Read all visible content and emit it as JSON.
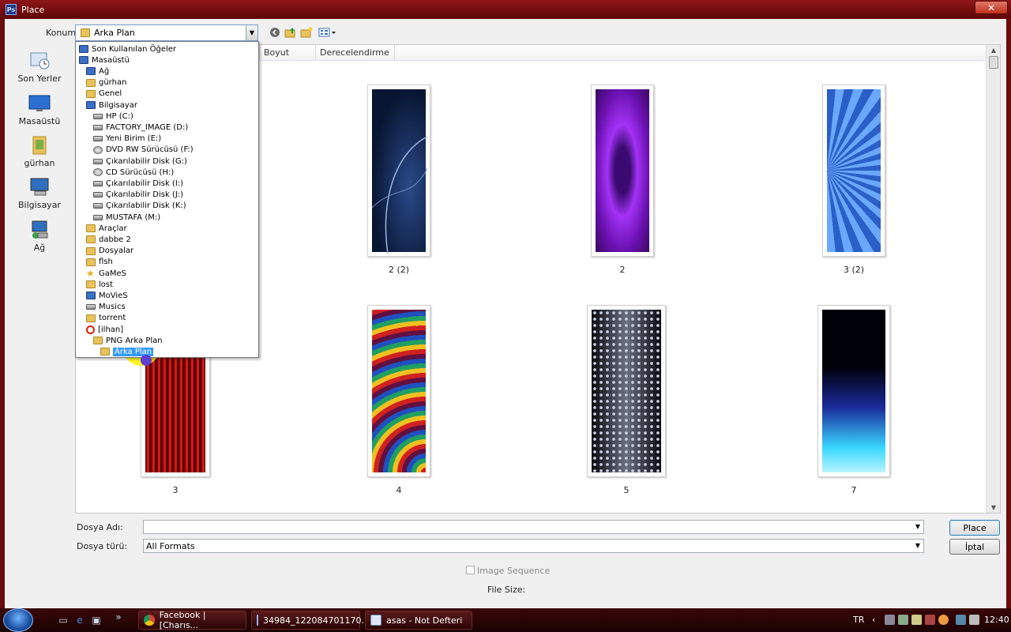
{
  "window": {
    "title": "Place",
    "close_glyph": "✕"
  },
  "location": {
    "label": "Konum:",
    "value": "Arka Plan"
  },
  "places": [
    {
      "label": "Son Yerler",
      "icon": "recent-places-icon"
    },
    {
      "label": "Masaüstü",
      "icon": "desktop-icon"
    },
    {
      "label": "gürhan",
      "icon": "user-folder-icon"
    },
    {
      "label": "Bilgisayar",
      "icon": "computer-icon"
    },
    {
      "label": "Ağ",
      "icon": "network-icon"
    }
  ],
  "columns": {
    "size": "Boyut",
    "rating": "Derecelendirme"
  },
  "files": [
    {
      "name": "2 (2)",
      "colors": [
        "#0a1a3a",
        "#1b3a6a"
      ]
    },
    {
      "name": "2",
      "colors": [
        "#5a0a9a",
        "#9b2df0"
      ]
    },
    {
      "name": "3 (2)",
      "colors": [
        "#2a5fc8",
        "#7ab8ff"
      ]
    },
    {
      "name": "3",
      "colors": [
        "#5a0000",
        "#d11a1a"
      ]
    },
    {
      "name": "4",
      "colors": [
        "#4a0a1a",
        "#f0a020"
      ]
    },
    {
      "name": "5",
      "colors": [
        "#0a0a10",
        "#9aa0b0"
      ]
    },
    {
      "name": "7",
      "colors": [
        "#000008",
        "#39d8ff"
      ]
    }
  ],
  "dropdown": [
    {
      "label": "Son Kullanılan Öğeler",
      "icon": "recent-items-icon",
      "indent": 0
    },
    {
      "label": "Masaüstü",
      "icon": "desktop-icon",
      "indent": 0
    },
    {
      "label": "Ağ",
      "icon": "network-icon",
      "indent": 1
    },
    {
      "label": "gürhan",
      "icon": "user-folder-icon",
      "indent": 1
    },
    {
      "label": "Genel",
      "icon": "folder-icon",
      "indent": 1
    },
    {
      "label": "Bilgisayar",
      "icon": "computer-icon",
      "indent": 1
    },
    {
      "label": "HP (C:)",
      "icon": "drive-icon",
      "indent": 2
    },
    {
      "label": "FACTORY_IMAGE (D:)",
      "icon": "drive-icon",
      "indent": 2
    },
    {
      "label": "Yeni Birim (E:)",
      "icon": "drive-icon",
      "indent": 2
    },
    {
      "label": "DVD RW Sürücüsü (F:)",
      "icon": "disc-drive-icon",
      "indent": 2
    },
    {
      "label": "Çıkarılabilir Disk (G:)",
      "icon": "removable-disk-icon",
      "indent": 2
    },
    {
      "label": "CD Sürücüsü (H:)",
      "icon": "disc-drive-icon",
      "indent": 2
    },
    {
      "label": "Çıkarılabilir Disk (I:)",
      "icon": "removable-disk-icon",
      "indent": 2
    },
    {
      "label": "Çıkarılabilir Disk (J:)",
      "icon": "removable-disk-icon",
      "indent": 2
    },
    {
      "label": "Çıkarılabilir Disk (K:)",
      "icon": "removable-disk-icon",
      "indent": 2
    },
    {
      "label": "MUSTAFA (M:)",
      "icon": "removable-disk-icon",
      "indent": 2
    },
    {
      "label": "Araçlar",
      "icon": "folder-icon",
      "indent": 1
    },
    {
      "label": "dabbe 2",
      "icon": "folder-icon",
      "indent": 1
    },
    {
      "label": "Dosyalar",
      "icon": "folder-icon",
      "indent": 1
    },
    {
      "label": "flsh",
      "icon": "folder-icon",
      "indent": 1
    },
    {
      "label": "GaMeS",
      "icon": "star-folder-icon",
      "indent": 1
    },
    {
      "label": "lost",
      "icon": "folder-icon",
      "indent": 1
    },
    {
      "label": "MoVieS",
      "icon": "video-folder-icon",
      "indent": 1
    },
    {
      "label": "Musics",
      "icon": "music-folder-icon",
      "indent": 1
    },
    {
      "label": "torrent",
      "icon": "folder-icon",
      "indent": 1
    },
    {
      "label": "[ilhan]",
      "icon": "blocked-folder-icon",
      "indent": 1
    },
    {
      "label": "PNG Arka Plan",
      "icon": "folder-icon",
      "indent": 2
    },
    {
      "label": "Arka Plan",
      "icon": "folder-icon",
      "indent": 3,
      "selected": true
    }
  ],
  "form": {
    "filename_label": "Dosya Adı:",
    "filename_value": "",
    "filetype_label": "Dosya türü:",
    "filetype_value": "All Formats",
    "place_button": "Place",
    "cancel_button": "İptal",
    "image_sequence": "Image Sequence",
    "file_size_label": "File Size:"
  },
  "taskbar": {
    "tasks": [
      {
        "label": "Facebook | [Charıs...",
        "icon": "chrome-icon"
      },
      {
        "label": "34984_122084701170...",
        "icon": "photoshop-icon"
      },
      {
        "label": "asas - Not Defteri",
        "icon": "notepad-icon"
      }
    ],
    "language": "TR",
    "clock": "12:40"
  }
}
